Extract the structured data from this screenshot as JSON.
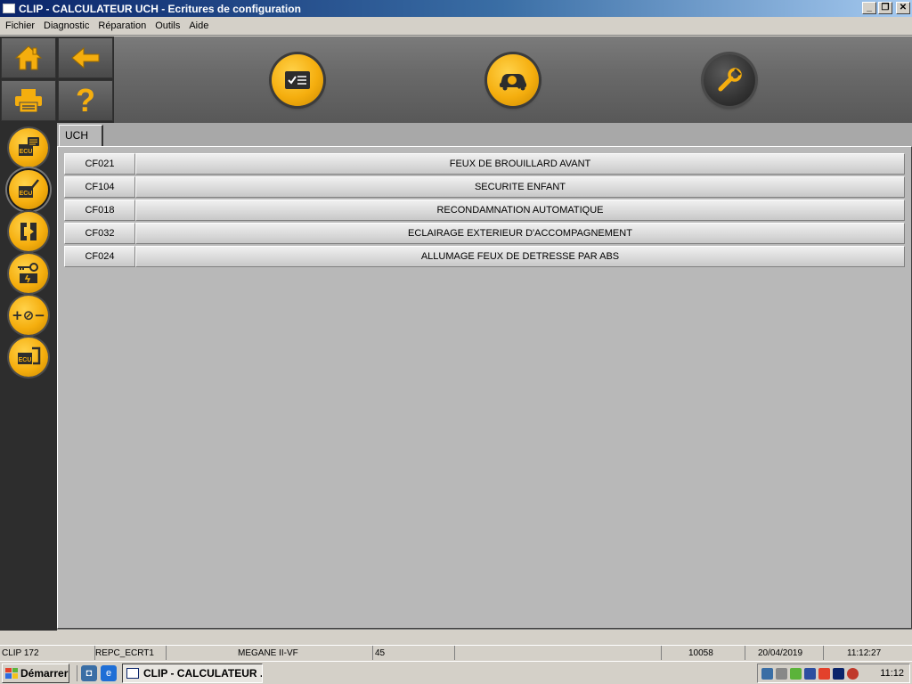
{
  "window": {
    "title": "CLIP - CALCULATEUR UCH - Ecritures de configuration",
    "minimize": "_",
    "maximize": "❐",
    "close": "✕"
  },
  "menu": [
    "Fichier",
    "Diagnostic",
    "Réparation",
    "Outils",
    "Aide"
  ],
  "toolbar": {
    "nav_buttons": [
      "home-icon",
      "back-arrow-icon",
      "printer-icon",
      "help-icon"
    ],
    "help_glyph": "?",
    "main_buttons": [
      "checklist-icon",
      "car-diagnostic-icon",
      "wrench-icon"
    ],
    "accent_color": "#f5ae0e"
  },
  "sidebar": {
    "buttons": [
      "ecu-info-icon",
      "ecu-write-icon",
      "bracket-icon",
      "key-engine-icon",
      "plus-minus-icon",
      "ecu-document-icon"
    ],
    "labels": {
      "ecu": "ECU",
      "plus_minus": "+⊘−"
    }
  },
  "tab": {
    "label": "UCH"
  },
  "rows": [
    {
      "code": "CF021",
      "label": "FEUX DE BROUILLARD AVANT"
    },
    {
      "code": "CF104",
      "label": "SECURITE ENFANT"
    },
    {
      "code": "CF018",
      "label": "RECONDAMNATION AUTOMATIQUE"
    },
    {
      "code": "CF032",
      "label": "ECLAIRAGE EXTERIEUR D'ACCOMPAGNEMENT"
    },
    {
      "code": "CF024",
      "label": "ALLUMAGE FEUX DE DETRESSE PAR ABS"
    }
  ],
  "status": {
    "device": "CLIP 172",
    "screen": "REPC_ECRT1",
    "vehicle": "MEGANE II-VF",
    "code": "45",
    "number": "10058",
    "date": "20/04/2019",
    "time": "11:12:27"
  },
  "taskbar": {
    "start": "Démarrer",
    "task": "CLIP - CALCULATEUR ...",
    "clock": "11:12"
  }
}
